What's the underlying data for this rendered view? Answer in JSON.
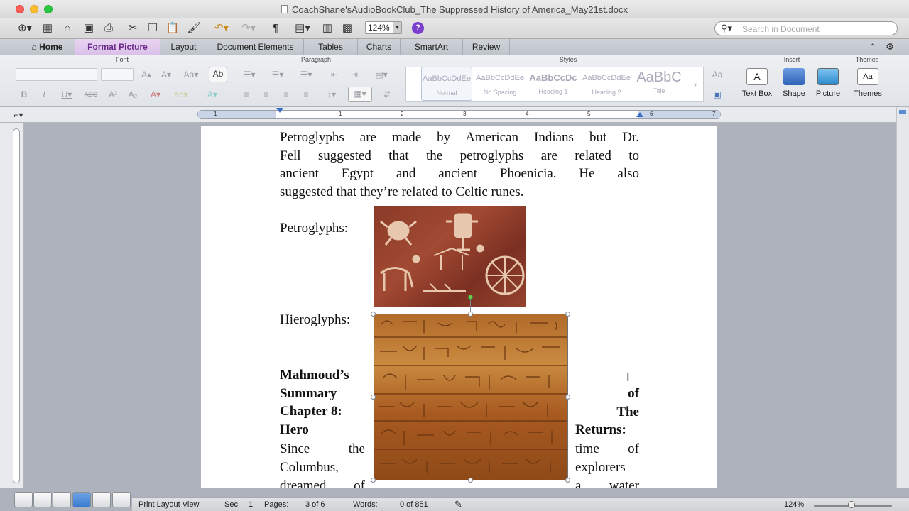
{
  "window": {
    "title": "CoachShane'sAudioBookClub_The Suppressed History of America_May21st.docx"
  },
  "toolbar": {
    "zoom": "124%",
    "search_placeholder": "Search in Document"
  },
  "tabs": [
    {
      "label": "Home"
    },
    {
      "label": "Format Picture"
    },
    {
      "label": "Layout"
    },
    {
      "label": "Document Elements"
    },
    {
      "label": "Tables"
    },
    {
      "label": "Charts"
    },
    {
      "label": "SmartArt"
    },
    {
      "label": "Review"
    }
  ],
  "ribbon": {
    "groups": {
      "font": "Font",
      "paragraph": "Paragraph",
      "styles": "Styles",
      "insert": "Insert",
      "themes": "Themes"
    },
    "styles": [
      {
        "sample": "AaBbCcDdEe",
        "name": "Normal"
      },
      {
        "sample": "AaBbCcDdEe",
        "name": "No Spacing"
      },
      {
        "sample": "AaBbCcDc",
        "name": "Heading 1"
      },
      {
        "sample": "AaBbCcDdEe",
        "name": "Heading 2"
      },
      {
        "sample": "AaBbC",
        "name": "Title"
      }
    ],
    "insert": {
      "text_box": "Text Box",
      "shape": "Shape",
      "picture": "Picture"
    },
    "themes": {
      "label": "Themes"
    }
  },
  "ruler_ticks": [
    "1",
    "1",
    "2",
    "3",
    "4",
    "5",
    "6",
    "7"
  ],
  "document": {
    "para1_lines": [
      "Petroglyphs are made by American Indians but Dr.",
      "Fell suggested that the petroglyphs are related to",
      "ancient Egypt and ancient Phoenicia. He also",
      "suggested that they’re related to Celtic runes."
    ],
    "petroglyphs_label": "Petroglyphs:",
    "hieroglyphs_label": "Hieroglyphs:",
    "heading_left": [
      "Mahmoud’s",
      "Summary",
      "Chapter 8:",
      "Hero"
    ],
    "heading_right": [
      "of",
      "The",
      "Returns:"
    ],
    "body_left": [
      "Since the",
      "Columbus,",
      "dreamed of"
    ],
    "body_right": [
      "time of",
      "explorers",
      "a water"
    ]
  },
  "status": {
    "view": "Print Layout View",
    "sec_label": "Sec",
    "sec_value": "1",
    "pages_label": "Pages:",
    "pages_value": "3 of 6",
    "words_label": "Words:",
    "words_value": "0 of 851",
    "zoom": "124%"
  }
}
